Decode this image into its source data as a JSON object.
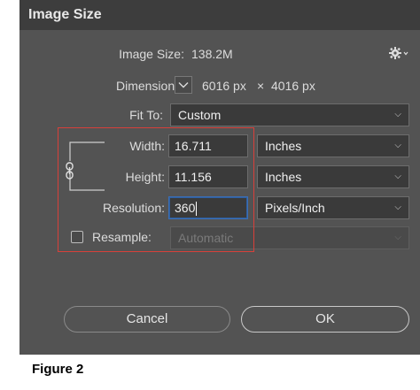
{
  "dialog": {
    "title": "Image Size",
    "image_size_label": "Image Size:",
    "image_size_value": "138.2M",
    "dimensions_label": "Dimensions:",
    "dimensions_width": "6016 px",
    "dimensions_times": "×",
    "dimensions_height": "4016 px",
    "fit_to_label": "Fit To:",
    "fit_to_value": "Custom",
    "width_label": "Width:",
    "width_value": "16.711",
    "width_unit": "Inches",
    "height_label": "Height:",
    "height_value": "11.156",
    "height_unit": "Inches",
    "resolution_label": "Resolution:",
    "resolution_value": "360",
    "resolution_unit": "Pixels/Inch",
    "resample_label": "Resample:",
    "resample_value": "Automatic",
    "resample_checked": false,
    "cancel_label": "Cancel",
    "ok_label": "OK"
  },
  "caption": "Figure 2",
  "colors": {
    "dialog_bg": "#535353",
    "titlebar_bg": "#3d3d3d",
    "highlight_box": "#d8403a",
    "active_field_border": "#3b6fb6"
  },
  "icons": [
    "gear-icon",
    "chevron-down-icon",
    "link-chain-icon"
  ]
}
